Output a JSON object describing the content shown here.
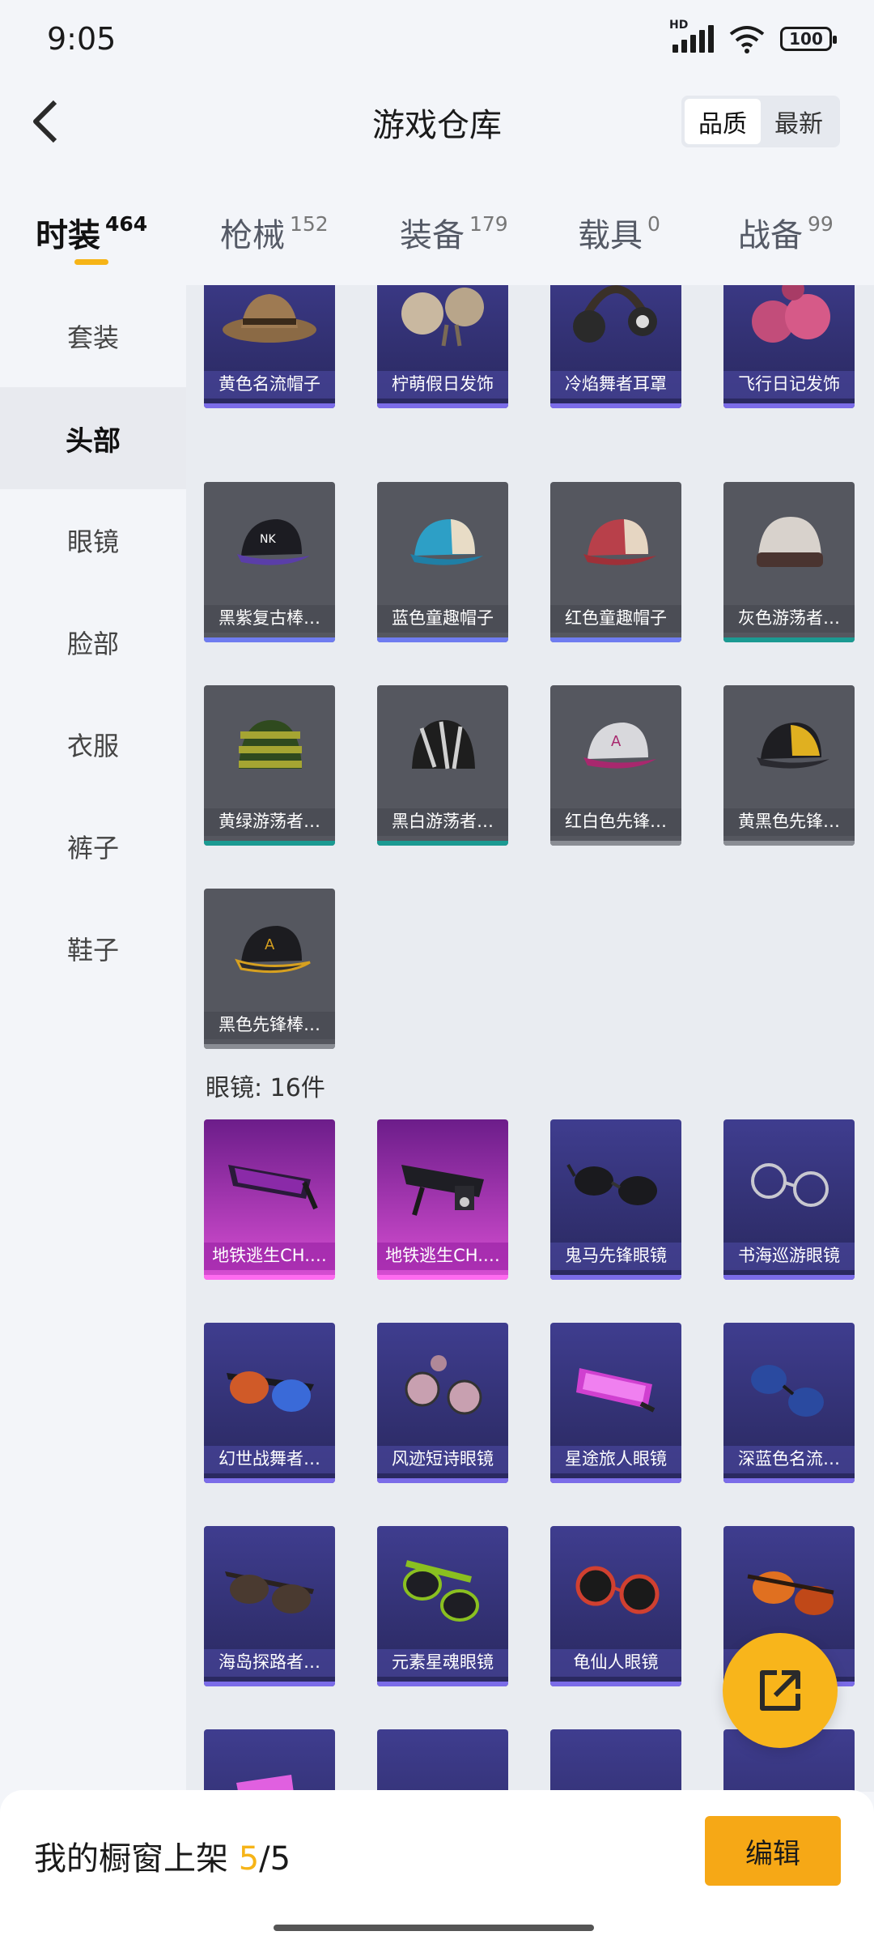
{
  "status": {
    "time": "9:05",
    "hd": "HD",
    "battery": "100"
  },
  "header": {
    "title": "游戏仓库",
    "sort_quality": "品质",
    "sort_latest": "最新"
  },
  "tabs": [
    {
      "label": "时装",
      "count": "464"
    },
    {
      "label": "枪械",
      "count": "152"
    },
    {
      "label": "装备",
      "count": "179"
    },
    {
      "label": "载具",
      "count": "0"
    },
    {
      "label": "战备",
      "count": "99"
    }
  ],
  "sidebar": [
    "套装",
    "头部",
    "眼镜",
    "脸部",
    "衣服",
    "裤子",
    "鞋子"
  ],
  "head_items": [
    "黄色名流帽子",
    "柠萌假日发饰",
    "冷焰舞者耳罩",
    "飞行日记发饰",
    "黑紫复古棒…",
    "蓝色童趣帽子",
    "红色童趣帽子",
    "灰色游荡者…",
    "黄绿游荡者…",
    "黑白游荡者…",
    "红白色先锋…",
    "黄黑色先锋…",
    "黑色先锋棒…"
  ],
  "glasses_section": "眼镜: 16件",
  "glasses_items": [
    "地铁逃生CH.…",
    "地铁逃生CH.…",
    "鬼马先锋眼镜",
    "书海巡游眼镜",
    "幻世战舞者…",
    "风迹短诗眼镜",
    "星途旅人眼镜",
    "深蓝色名流…",
    "海岛探路者…",
    "元素星魂眼镜",
    "龟仙人眼镜",
    "…眼镜"
  ],
  "bottom": {
    "prefix": "我的橱窗上架 ",
    "count": "5",
    "suffix": "/5",
    "edit": "编辑"
  },
  "icons": [
    "back-arrow-icon",
    "signal-icon",
    "wifi-icon",
    "battery-icon",
    "share-icon"
  ],
  "colors": {
    "accent": "#f6b417",
    "button": "#f6a816",
    "rare_purple": "#3f3d8f",
    "epic_pink": "#d84fd3"
  }
}
